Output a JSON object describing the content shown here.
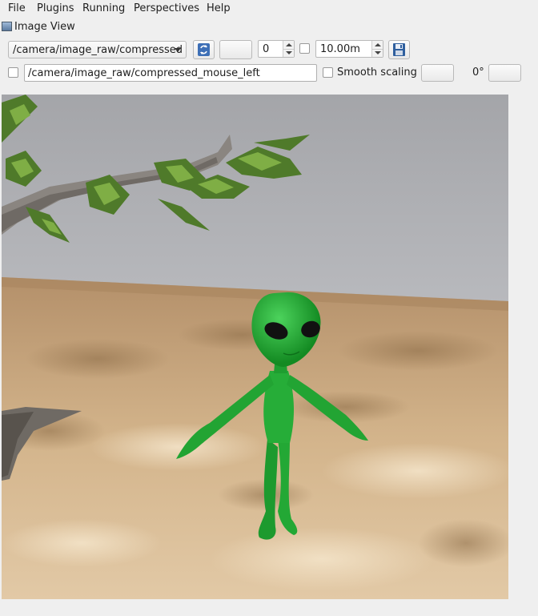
{
  "menubar": {
    "items": [
      {
        "label": "File"
      },
      {
        "label": "Plugins"
      },
      {
        "label": "Running"
      },
      {
        "label": "Perspectives"
      },
      {
        "label": "Help"
      }
    ]
  },
  "plugin": {
    "title": "Image View"
  },
  "toolbar": {
    "topic": "/camera/image_raw/compressed",
    "spin_value": "0",
    "duration_value": "10.00m",
    "mouse_topic": "/camera/image_raw/compressed_mouse_left",
    "smooth_label": "Smooth scaling",
    "rotation": "0°"
  },
  "colors": {
    "background": "#efefef",
    "sky": "#b3b4b8",
    "ground": "#c9a77a",
    "alien": "#1fa131"
  },
  "icons": [
    "image-view-icon",
    "refresh-icon",
    "save-icon"
  ]
}
